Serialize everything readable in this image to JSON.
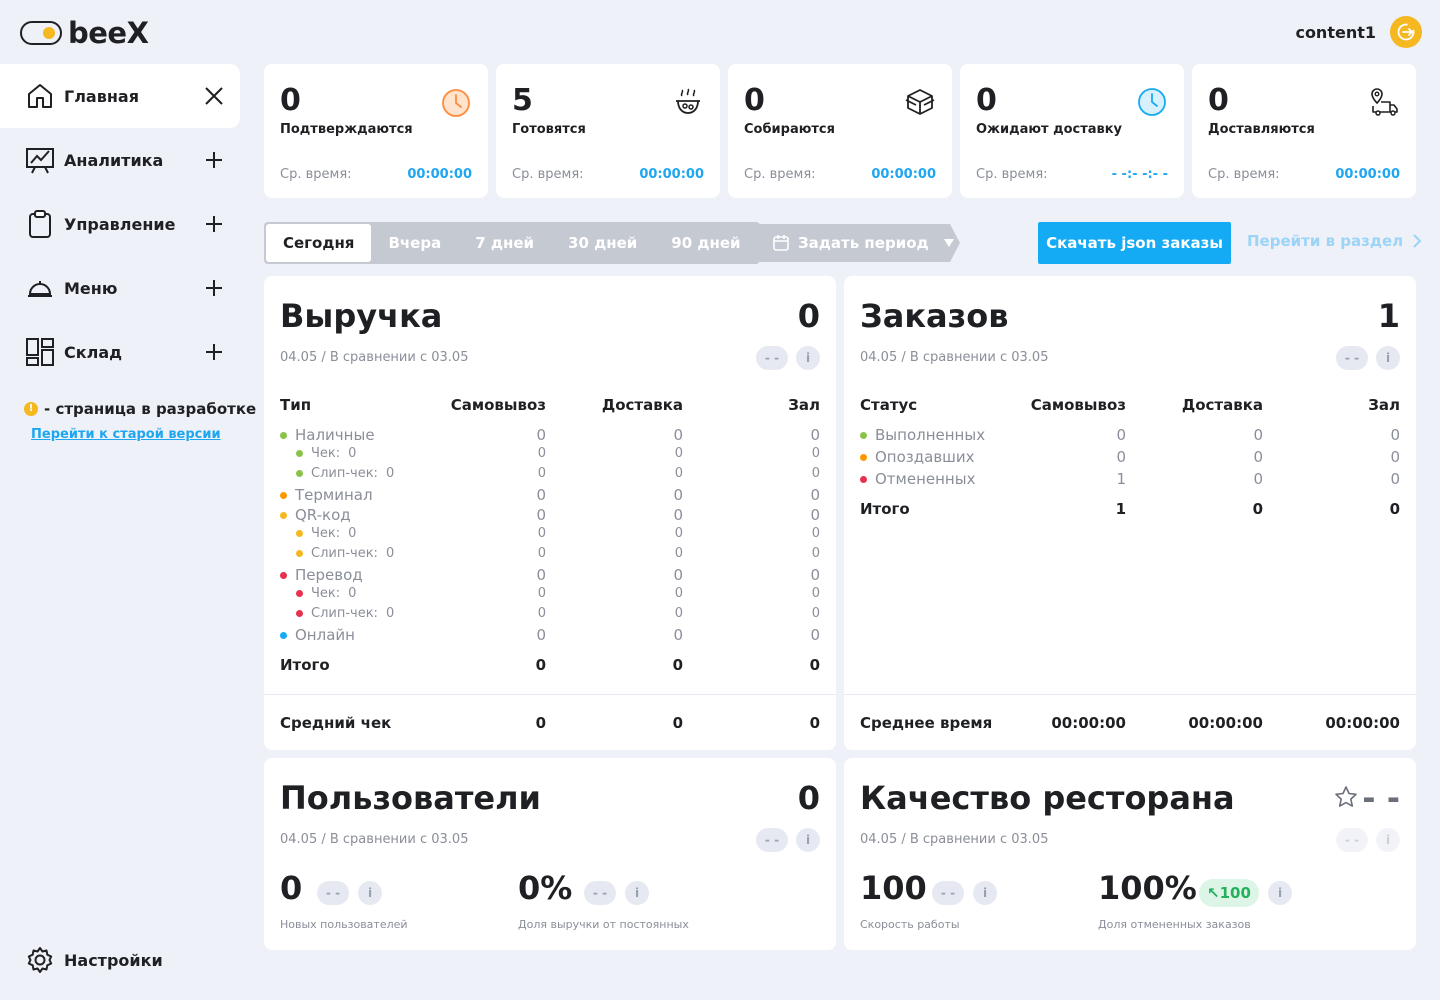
{
  "header": {
    "logo_text": "beeX",
    "user_name": "content1"
  },
  "sidebar": {
    "items": [
      {
        "label": "Главная",
        "icon": "home-icon"
      },
      {
        "label": "Аналитика",
        "icon": "chart-icon"
      },
      {
        "label": "Управление",
        "icon": "clipboard-icon"
      },
      {
        "label": "Меню",
        "icon": "cloche-icon"
      },
      {
        "label": "Склад",
        "icon": "grid-icon"
      }
    ],
    "dev_note": "- страница в разработке",
    "old_version_link": "Перейти к старой версии",
    "settings_label": "Настройки"
  },
  "stats": [
    {
      "value": "0",
      "label": "Подтверждаются",
      "time_label": "Ср. время:",
      "time": "00:00:00",
      "icon": "timer-icon"
    },
    {
      "value": "5",
      "label": "Готовятся",
      "time_label": "Ср. время:",
      "time": "00:00:00",
      "icon": "cooking-pot-icon"
    },
    {
      "value": "0",
      "label": "Собираются",
      "time_label": "Ср. время:",
      "time": "00:00:00",
      "icon": "box-icon"
    },
    {
      "value": "0",
      "label": "Ожидают доставку",
      "time_label": "Ср. время:",
      "time": "- -:- -:- -",
      "icon": "clock-icon"
    },
    {
      "value": "0",
      "label": "Доставляются",
      "time_label": "Ср. время:",
      "time": "00:00:00",
      "icon": "delivery-truck-icon"
    }
  ],
  "filters": {
    "tabs": [
      "Сегодня",
      "Вчера",
      "7 дней",
      "30 дней",
      "90 дней"
    ],
    "active_tab": "Сегодня",
    "period_label": "Задать период",
    "download_label": "Скачать json заказы",
    "goto_label": "Перейти в раздел"
  },
  "revenue": {
    "title": "Выручка",
    "total": "0",
    "subtitle": "04.05 / В сравнении с 03.05",
    "delta": "- -",
    "info": "i",
    "headers": [
      "Тип",
      "Самовывоз",
      "Доставка",
      "Зал"
    ],
    "rows": [
      {
        "label": "Наличные",
        "vals": [
          "0",
          "0",
          "0"
        ]
      },
      {
        "label": "Чек:",
        "sub": "0",
        "vals": [
          "0",
          "0",
          "0"
        ]
      },
      {
        "label": "Слип-чек:",
        "sub": "0",
        "vals": [
          "0",
          "0",
          "0"
        ]
      },
      {
        "label": "Терминал",
        "vals": [
          "0",
          "0",
          "0"
        ]
      },
      {
        "label": "QR-код",
        "vals": [
          "0",
          "0",
          "0"
        ]
      },
      {
        "label": "Чек:",
        "sub": "0",
        "vals": [
          "0",
          "0",
          "0"
        ]
      },
      {
        "label": "Слип-чек:",
        "sub": "0",
        "vals": [
          "0",
          "0",
          "0"
        ]
      },
      {
        "label": "Перевод",
        "vals": [
          "0",
          "0",
          "0"
        ]
      },
      {
        "label": "Чек:",
        "sub": "0",
        "vals": [
          "0",
          "0",
          "0"
        ]
      },
      {
        "label": "Слип-чек:",
        "sub": "0",
        "vals": [
          "0",
          "0",
          "0"
        ]
      },
      {
        "label": "Онлайн",
        "vals": [
          "0",
          "0",
          "0"
        ]
      }
    ],
    "total_row": {
      "label": "Итого",
      "vals": [
        "0",
        "0",
        "0"
      ]
    },
    "avg_row": {
      "label": "Средний чек",
      "vals": [
        "0",
        "0",
        "0"
      ]
    }
  },
  "orders": {
    "title": "Заказов",
    "total": "1",
    "subtitle": "04.05 / В сравнении с 03.05",
    "delta": "- -",
    "info": "i",
    "headers": [
      "Статус",
      "Самовывоз",
      "Доставка",
      "Зал"
    ],
    "rows": [
      {
        "label": "Выполненных",
        "vals": [
          "0",
          "0",
          "0"
        ]
      },
      {
        "label": "Опоздавших",
        "vals": [
          "0",
          "0",
          "0"
        ]
      },
      {
        "label": "Отмененных",
        "vals": [
          "1",
          "0",
          "0"
        ]
      }
    ],
    "total_row": {
      "label": "Итого",
      "vals": [
        "1",
        "0",
        "0"
      ]
    },
    "avg_row": {
      "label": "Среднее время",
      "vals": [
        "00:00:00",
        "00:00:00",
        "00:00:00"
      ]
    }
  },
  "users": {
    "title": "Пользователи",
    "total": "0",
    "subtitle": "04.05 / В сравнении с 03.05",
    "delta": "- -",
    "info": "i",
    "metrics": [
      {
        "value": "0",
        "delta": "- -",
        "label": "Новых пользователей"
      },
      {
        "value": "0%",
        "delta": "- -",
        "label": "Доля выручки от постоянных"
      }
    ]
  },
  "quality": {
    "title": "Качество ресторана",
    "total": "- -",
    "subtitle": "04.05 / В сравнении с 03.05",
    "delta": "- -",
    "info": "i",
    "metrics": [
      {
        "value": "100",
        "delta": "- -",
        "label": "Скорость работы"
      },
      {
        "value": "100%",
        "delta": "↖100",
        "label": "Доля отмененных заказов"
      }
    ]
  },
  "colors": {
    "accent": "#15ABF4",
    "yellow": "#F5B820",
    "green": "#8BC34A",
    "orange": "#FF9800",
    "yellow_dot": "#F5B820",
    "red": "#E8304F",
    "blue": "#15ABF4"
  }
}
